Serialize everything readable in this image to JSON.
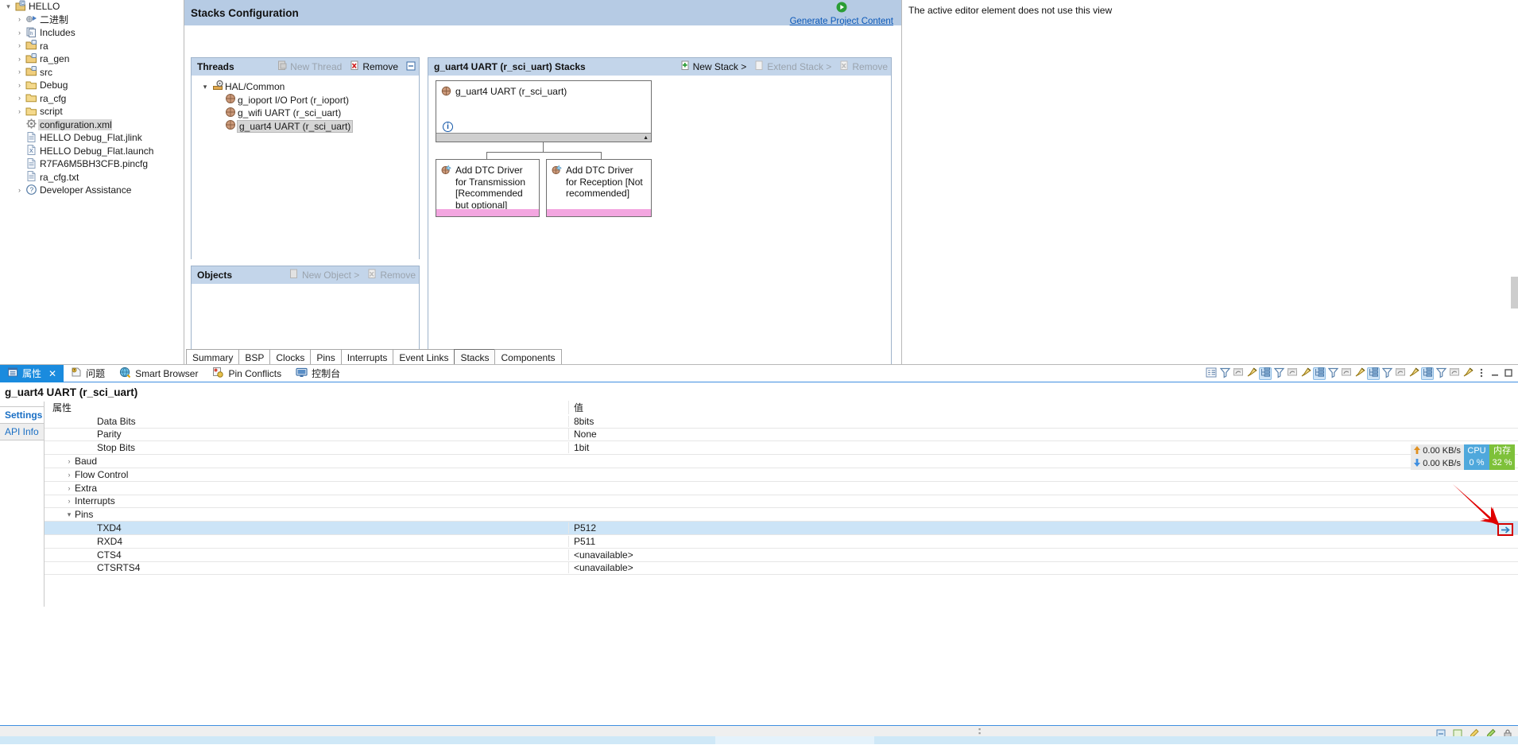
{
  "project_explorer": {
    "items": [
      {
        "label": "HELLO",
        "twisty": "▾",
        "icon": "c-project-icon",
        "indent": 0,
        "selected": false
      },
      {
        "label": "二进制",
        "twisty": "›",
        "icon": "binaries-icon",
        "indent": 1,
        "selected": false
      },
      {
        "label": "Includes",
        "twisty": "›",
        "icon": "includes-icon",
        "indent": 1,
        "selected": false
      },
      {
        "label": "ra",
        "twisty": "›",
        "icon": "source-folder-icon",
        "indent": 1,
        "selected": false
      },
      {
        "label": "ra_gen",
        "twisty": "›",
        "icon": "source-folder-icon",
        "indent": 1,
        "selected": false
      },
      {
        "label": "src",
        "twisty": "›",
        "icon": "source-folder-icon",
        "indent": 1,
        "selected": false
      },
      {
        "label": "Debug",
        "twisty": "›",
        "icon": "folder-icon",
        "indent": 1,
        "selected": false
      },
      {
        "label": "ra_cfg",
        "twisty": "›",
        "icon": "folder-icon",
        "indent": 1,
        "selected": false
      },
      {
        "label": "script",
        "twisty": "›",
        "icon": "folder-icon",
        "indent": 1,
        "selected": false
      },
      {
        "label": "configuration.xml",
        "twisty": "",
        "icon": "gear-icon",
        "indent": 1,
        "selected": true
      },
      {
        "label": "HELLO Debug_Flat.jlink",
        "twisty": "",
        "icon": "file-icon",
        "indent": 1,
        "selected": false
      },
      {
        "label": "HELLO Debug_Flat.launch",
        "twisty": "",
        "icon": "launch-file-icon",
        "indent": 1,
        "selected": false
      },
      {
        "label": "R7FA6M5BH3CFB.pincfg",
        "twisty": "",
        "icon": "file-icon",
        "indent": 1,
        "selected": false
      },
      {
        "label": "ra_cfg.txt",
        "twisty": "",
        "icon": "file-icon",
        "indent": 1,
        "selected": false
      },
      {
        "label": "Developer Assistance",
        "twisty": "›",
        "icon": "help-icon",
        "indent": 1,
        "selected": false
      }
    ]
  },
  "editor": {
    "title": "Stacks Configuration",
    "generate_link": "Generate Project Content",
    "generate_icon": "generate-play-icon",
    "threads_panel": {
      "title": "Threads",
      "new_thread_label": "New Thread",
      "new_thread_icon": "new-thread-icon",
      "remove_label": "Remove",
      "remove_icon": "remove-icon",
      "collapse_icon": "collapse-all-icon",
      "tree": [
        {
          "label": "HAL/Common",
          "twisty": "▾",
          "icon": "hal-common-icon",
          "indent": 0,
          "selected": false
        },
        {
          "label": "g_ioport I/O Port (r_ioport)",
          "twisty": "",
          "icon": "module-icon",
          "indent": 1,
          "selected": false
        },
        {
          "label": "g_wifi UART (r_sci_uart)",
          "twisty": "",
          "icon": "module-icon",
          "indent": 1,
          "selected": false
        },
        {
          "label": "g_uart4 UART (r_sci_uart)",
          "twisty": "",
          "icon": "module-icon",
          "indent": 1,
          "selected": true
        }
      ]
    },
    "objects_panel": {
      "title": "Objects",
      "new_object_label": "New Object >",
      "new_object_icon": "new-object-icon",
      "remove_label": "Remove",
      "remove_icon": "remove-icon",
      "items": []
    },
    "stacks_panel": {
      "title": "g_uart4 UART (r_sci_uart) Stacks",
      "new_stack_label": "New Stack >",
      "new_stack_icon": "new-stack-icon",
      "extend_stack_label": "Extend Stack >",
      "extend_stack_icon": "extend-stack-icon",
      "remove_label": "Remove",
      "remove_icon": "remove-icon",
      "modules": [
        {
          "name": "g_uart4 UART (r_sci_uart)",
          "icon": "module-icon",
          "has_info": true,
          "info_icon": "info-icon",
          "has_scrollbar": true
        },
        {
          "name": "Add DTC Driver for Transmission [Recommended but optional]",
          "icon": "add-module-icon",
          "footer_color": "#f3a6e0"
        },
        {
          "name": "Add DTC Driver for Reception [Not recommended]",
          "icon": "add-module-icon",
          "footer_color": "#f3a6e0"
        }
      ]
    },
    "tabs": [
      {
        "label": "Summary",
        "active": false
      },
      {
        "label": "BSP",
        "active": false
      },
      {
        "label": "Clocks",
        "active": false
      },
      {
        "label": "Pins",
        "active": false
      },
      {
        "label": "Interrupts",
        "active": false
      },
      {
        "label": "Event Links",
        "active": false
      },
      {
        "label": "Stacks",
        "active": true
      },
      {
        "label": "Components",
        "active": false
      }
    ]
  },
  "right_view": {
    "message": "The active editor element does not use this view"
  },
  "bottom_view": {
    "tabs": [
      {
        "label": "属性",
        "icon": "properties-icon",
        "active": true,
        "closable": true,
        "close_label": "✕"
      },
      {
        "label": "问题",
        "icon": "problems-icon",
        "active": false,
        "closable": false
      },
      {
        "label": "Smart Browser",
        "icon": "smart-browser-icon",
        "active": false,
        "closable": false
      },
      {
        "label": "Pin Conflicts",
        "icon": "pin-conflicts-icon",
        "active": false,
        "closable": false
      },
      {
        "label": "控制台",
        "icon": "console-icon",
        "active": false,
        "closable": false
      }
    ],
    "toolbar": [
      {
        "icon": "new-view-icon",
        "active": false
      },
      {
        "icon": "filter-icon",
        "active": false
      },
      {
        "icon": "restore-icon",
        "active": false
      },
      {
        "icon": "pin-icon",
        "active": false
      },
      {
        "icon": "tree-icon",
        "active": true
      },
      {
        "icon": "filter-icon",
        "active": false
      },
      {
        "icon": "restore-icon",
        "active": false
      },
      {
        "icon": "pin-icon",
        "active": false
      },
      {
        "icon": "tree-icon",
        "active": true
      },
      {
        "icon": "filter-icon",
        "active": false
      },
      {
        "icon": "restore-icon",
        "active": false
      },
      {
        "icon": "pin-icon",
        "active": false
      },
      {
        "icon": "tree-icon",
        "active": true
      },
      {
        "icon": "filter-icon",
        "active": false
      },
      {
        "icon": "restore-icon",
        "active": false
      },
      {
        "icon": "pin-icon",
        "active": false
      },
      {
        "icon": "tree-icon",
        "active": true
      },
      {
        "icon": "filter-icon",
        "active": false
      },
      {
        "icon": "restore-icon",
        "active": false
      },
      {
        "icon": "pin-icon",
        "active": false
      },
      {
        "icon": "view-menu-icon",
        "active": false
      },
      {
        "icon": "minimize-icon",
        "active": false
      },
      {
        "icon": "maximize-icon",
        "active": false
      }
    ],
    "title": "g_uart4 UART (r_sci_uart)",
    "side_tabs": [
      {
        "label": "Settings",
        "active": true
      },
      {
        "label": "API Info",
        "active": false
      }
    ],
    "columns": {
      "property": "属性",
      "value": "值"
    },
    "rows": [
      {
        "name": "Data Bits",
        "value": "8bits",
        "level": 2,
        "twisty": "",
        "selected": false
      },
      {
        "name": "Parity",
        "value": "None",
        "level": 2,
        "twisty": "",
        "selected": false
      },
      {
        "name": "Stop Bits",
        "value": "1bit",
        "level": 2,
        "twisty": "",
        "selected": false
      },
      {
        "name": "Baud",
        "value": "",
        "level": 1,
        "twisty": "›",
        "selected": false
      },
      {
        "name": "Flow Control",
        "value": "",
        "level": 1,
        "twisty": "›",
        "selected": false
      },
      {
        "name": "Extra",
        "value": "",
        "level": 1,
        "twisty": "›",
        "selected": false
      },
      {
        "name": "Interrupts",
        "value": "",
        "level": 1,
        "twisty": "›",
        "selected": false
      },
      {
        "name": "Pins",
        "value": "",
        "level": 1,
        "twisty": "▾",
        "selected": false
      },
      {
        "name": "TXD4",
        "value": "P512",
        "level": 2,
        "twisty": "",
        "selected": true
      },
      {
        "name": "RXD4",
        "value": "P511",
        "level": 2,
        "twisty": "",
        "selected": false
      },
      {
        "name": "CTS4",
        "value": "<unavailable>",
        "level": 2,
        "twisty": "",
        "selected": false
      },
      {
        "name": "CTSRTS4",
        "value": "<unavailable>",
        "level": 2,
        "twisty": "",
        "selected": false
      }
    ]
  },
  "perf_widget": {
    "upload": "0.00 KB/s",
    "download": "0.00 KB/s",
    "upload_icon": "arrow-up-icon",
    "download_icon": "arrow-down-icon",
    "cpu_label": "CPU",
    "cpu_value": "0 %",
    "mem_label": "内存",
    "mem_value": "32 %",
    "cpu_color": "#4fa8dc",
    "mem_color": "#7ec13a"
  },
  "annotation": {
    "arrow_icon": "red-arrow-annotation",
    "arrow_color": "#d40000",
    "target_icon": "edit-value-button"
  },
  "status_bar": {
    "dots_icon": "drag-handle-icon",
    "icons": [
      "writable-icon",
      "insert-mode-icon",
      "edit-icon",
      "smart-insert-icon",
      "lock-icon"
    ]
  }
}
